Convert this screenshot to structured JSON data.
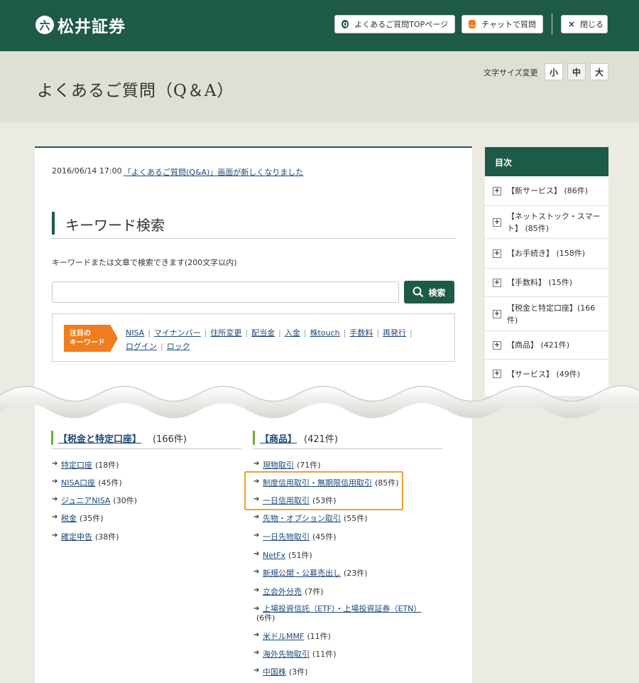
{
  "header": {
    "logo_mark": "六",
    "logo_text": "松井証券",
    "faq_top_label": "よくあるご質問TOPページ",
    "chat_label": "チャットで質問",
    "close_label": "閉じる",
    "close_glyph": "×"
  },
  "title_band": {
    "title": "よくあるご質問（Q＆A）",
    "font_size_label": "文字サイズ変更",
    "font_sizes": [
      "小",
      "中",
      "大"
    ],
    "active_font_size": "中"
  },
  "news": {
    "date": "2016/06/14 17:00",
    "link": "「よくあるご質問(Q&A)」画面が新しくなりました"
  },
  "search": {
    "heading": "キーワード検索",
    "help": "キーワードまたは文章で検索できます(200文字以内)",
    "placeholder": "",
    "button_label": "検索",
    "keyword_tag": [
      "注目の",
      "キーワード"
    ],
    "keywords": [
      "NISA",
      "マイナンバー",
      "住所変更",
      "配当金",
      "入金",
      "株touch",
      "手数料",
      "再発行",
      "ログイン",
      "ロック"
    ]
  },
  "toc": {
    "title": "目次",
    "items": [
      {
        "label": "【新サービス】 (86件)",
        "lines": 1
      },
      {
        "label": "【ネットストック・スマート】 (85件)",
        "lines": 2
      },
      {
        "label": "【お手続き】 (158件)",
        "lines": 1
      },
      {
        "label": "【手数料】 (15件)",
        "lines": 1
      },
      {
        "label": "【税金と特定口座】(166件)",
        "lines": 2
      },
      {
        "label": "【商品】 (421件)",
        "lines": 1
      },
      {
        "label": "【サービス】 (49件)",
        "lines": 1
      }
    ]
  },
  "categories": {
    "left": {
      "name": "【税金と特定口座】",
      "count": "(166件)",
      "items": [
        {
          "label": "特定口座",
          "count": "(18件)"
        },
        {
          "label": "NISA口座",
          "count": "(45件)"
        },
        {
          "label": "ジュニアNISA",
          "count": "(30件)"
        },
        {
          "label": "税金",
          "count": "(35件)"
        },
        {
          "label": "確定申告",
          "count": "(38件)"
        }
      ]
    },
    "right": {
      "name": "【商品】",
      "count": "(421件)",
      "items": [
        {
          "label": "現物取引",
          "count": "(71件)"
        },
        {
          "label": "制度信用取引・無期限信用取引",
          "count": "(85件)"
        },
        {
          "label": "一日信用取引",
          "count": "(53件)"
        },
        {
          "label": "先物・オプション取引",
          "count": "(55件)"
        },
        {
          "label": "一日先物取引",
          "count": "(45件)"
        },
        {
          "label": "NetFx",
          "count": "(51件)"
        },
        {
          "label": "新規公開・公募売出し",
          "count": "(23件)"
        },
        {
          "label": "立会外分売",
          "count": "(7件)"
        },
        {
          "label": "上場投資信託（ETF）・上場投資証券（ETN）",
          "count": "(6件)"
        },
        {
          "label": "米ドルMMF",
          "count": "(11件)"
        },
        {
          "label": "海外先物取引",
          "count": "(11件)"
        },
        {
          "label": "中国株",
          "count": "(3件)"
        }
      ]
    }
  },
  "colors": {
    "brand_green": "#1d5a47",
    "accent_orange": "#f07d1e",
    "highlight_orange": "#f0a030",
    "link_blue": "#1d4a7a"
  }
}
